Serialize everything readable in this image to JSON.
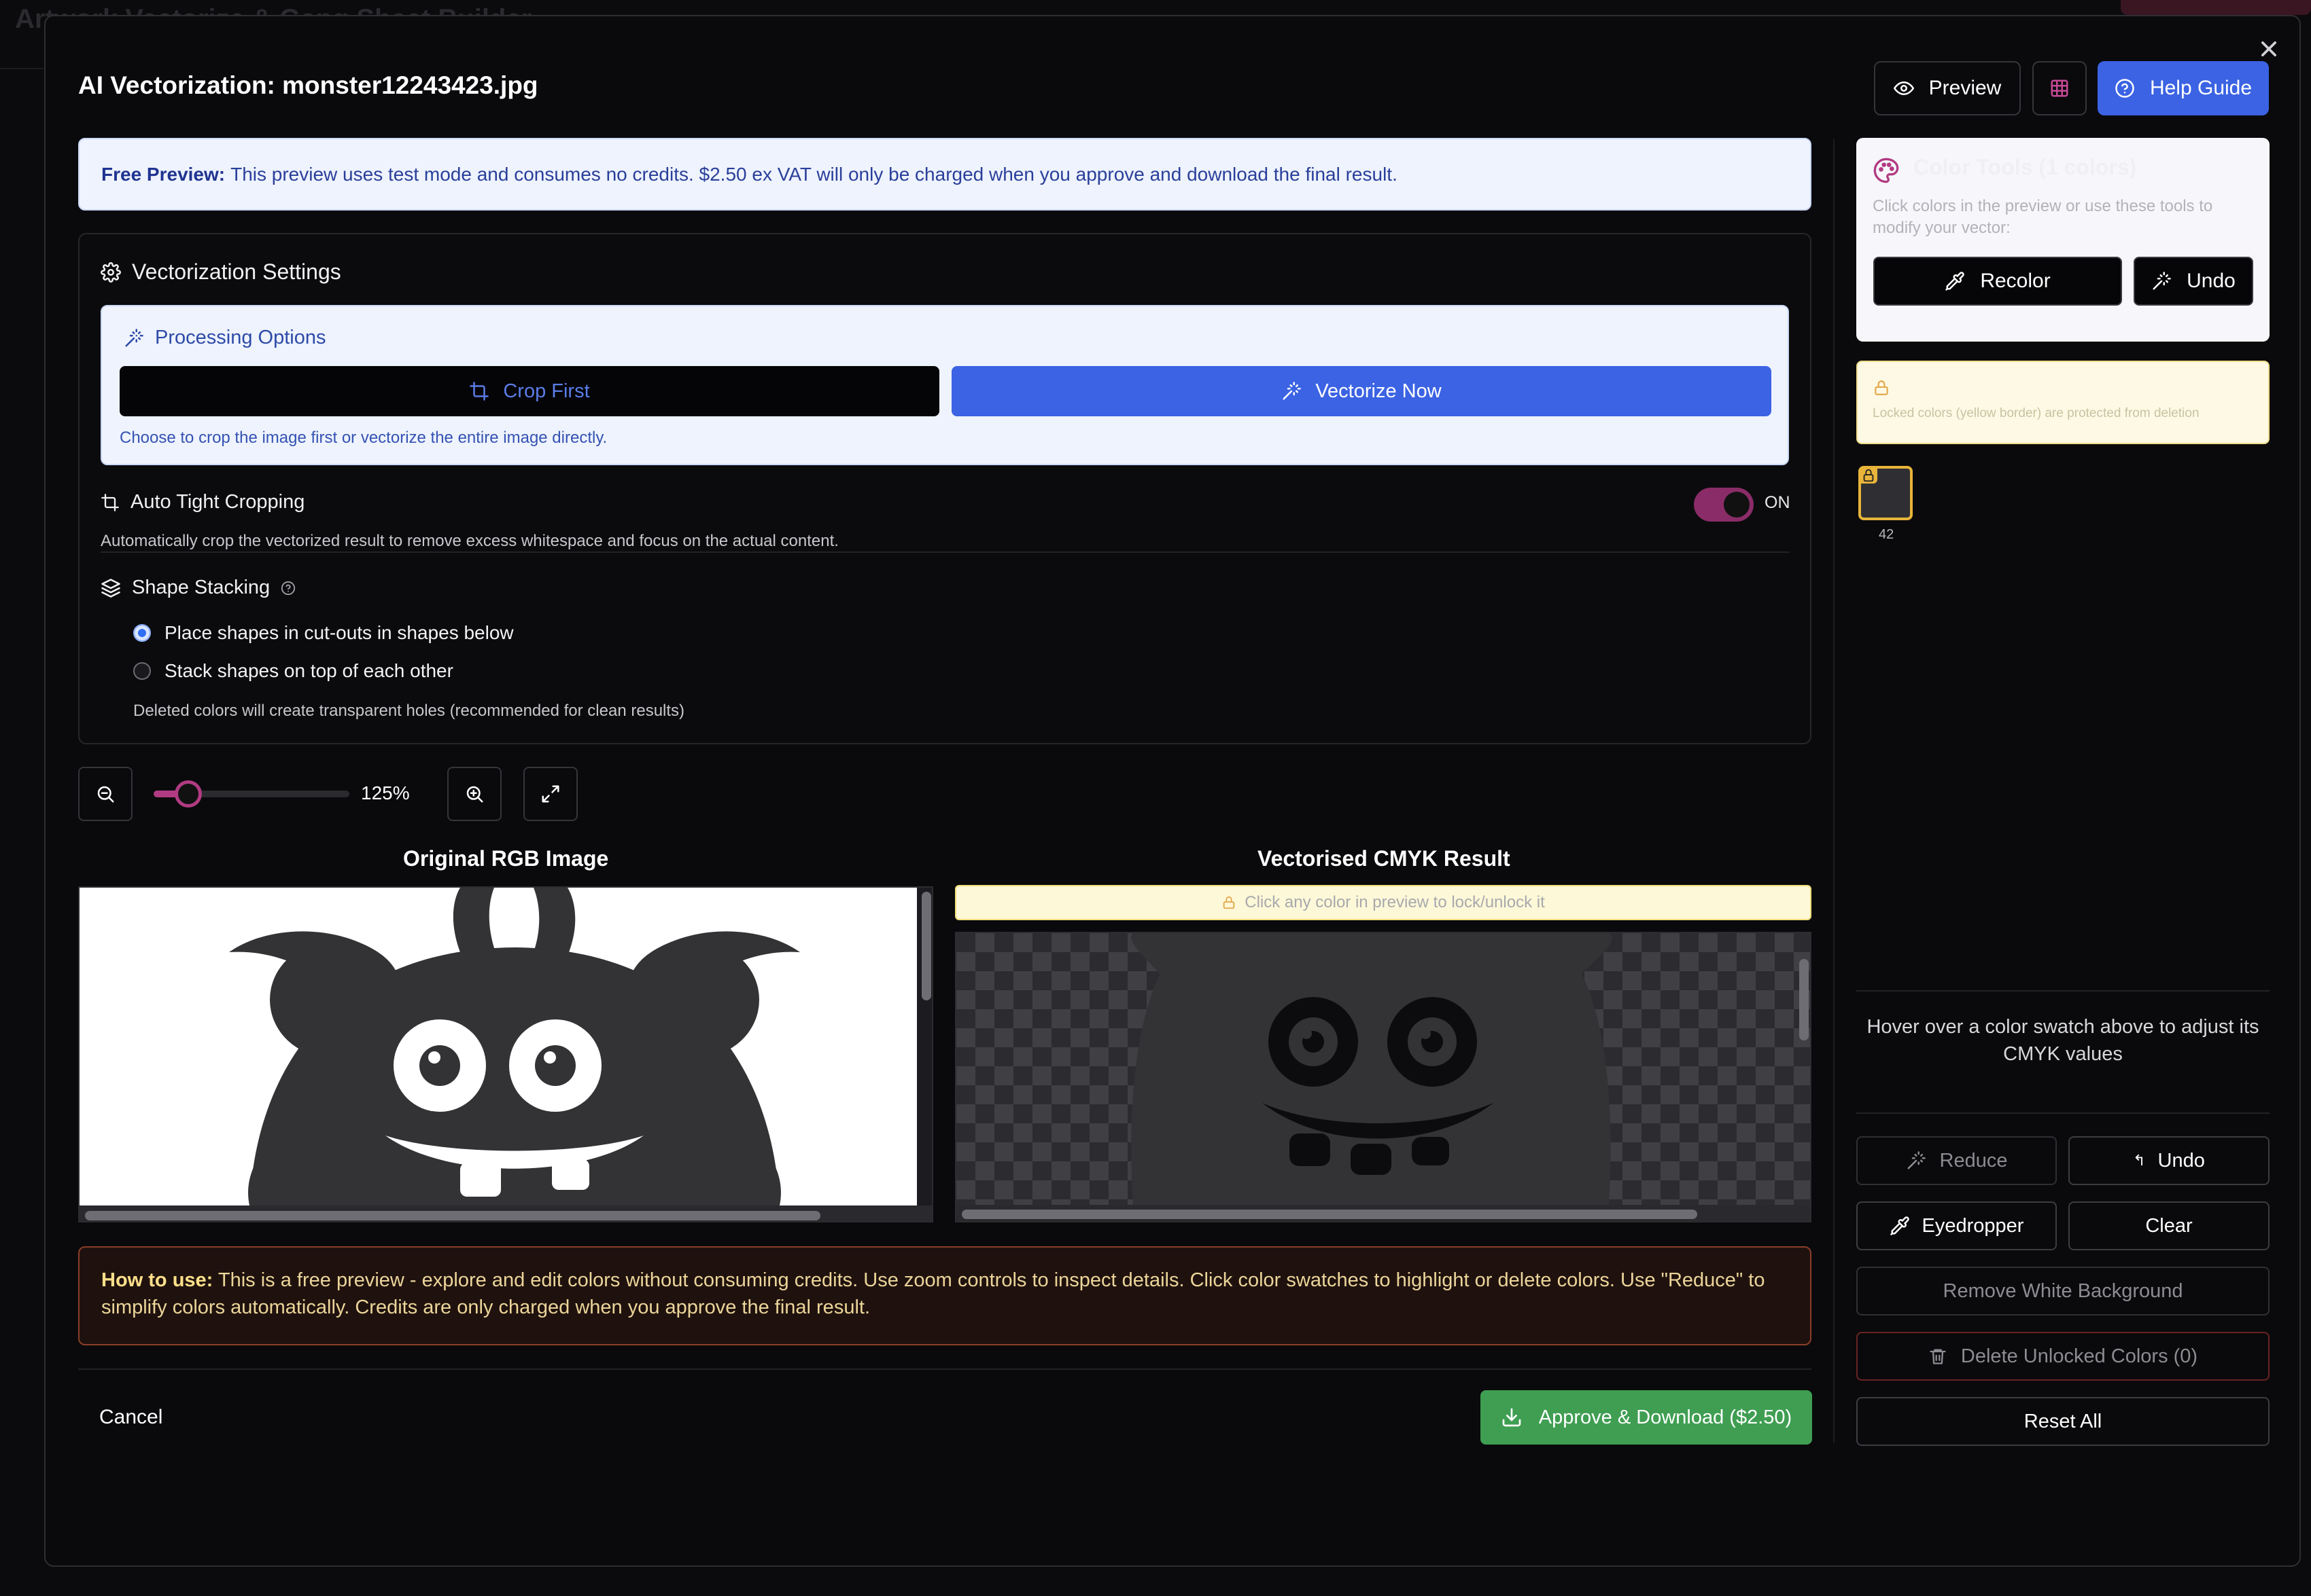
{
  "background_app": {
    "title": "Artwork Vectorize & Gang Sheet Builder"
  },
  "modal": {
    "title": "AI Vectorization: monster12243423.jpg",
    "close_icon": "close-icon",
    "header_buttons": {
      "preview": "Preview",
      "help": "Help Guide"
    }
  },
  "banner": {
    "bold": "Free Preview:",
    "text": "This preview uses test mode and consumes no credits. $2.50 ex VAT will only be charged when you approve and download the final result."
  },
  "settings": {
    "title": "Vectorization Settings",
    "processing": {
      "title": "Processing Options",
      "crop_label": "Crop First",
      "vectorize_label": "Vectorize Now",
      "note": "Choose to crop the image first or vectorize the entire image directly."
    },
    "auto_crop": {
      "title": "Auto Tight Cropping",
      "state": "ON",
      "enabled": true,
      "description": "Automatically crop the vectorized result to remove excess whitespace and focus on the actual content."
    },
    "shape_stacking": {
      "title": "Shape Stacking",
      "options": [
        "Place shapes in cut-outs in shapes below",
        "Stack shapes on top of each other"
      ],
      "selected": 0,
      "note": "Deleted colors will create transparent holes (recommended for clean results)"
    }
  },
  "zoom": {
    "value": "125%",
    "level_fraction": 0.12
  },
  "panels": {
    "original_title": "Original RGB Image",
    "vector_title": "Vectorised CMYK Result",
    "lock_hint": "Click any color in preview to lock/unlock it"
  },
  "howto": {
    "bold": "How to use:",
    "text": "This is a free preview - explore and edit colors without consuming credits. Use zoom controls to inspect details. Click color swatches to highlight or delete colors. Use \"Reduce\" to simplify colors automatically. Credits are only charged when you approve the final result."
  },
  "footer": {
    "cancel": "Cancel",
    "approve": "Approve & Download ($2.50)"
  },
  "color_tools": {
    "title": "Color Tools (1 colors)",
    "description": "Click colors in the preview or use these tools to modify your vector:",
    "recolor": "Recolor",
    "undo": "Undo",
    "lock_note": "Locked colors (yellow border) are protected from deletion",
    "swatches": [
      {
        "count": "42",
        "color": "#2f2f33",
        "locked": true
      }
    ],
    "hover_text": "Hover over a color swatch above to adjust its CMYK values",
    "reduce": "Reduce",
    "undo2": "Undo",
    "eyedropper": "Eyedropper",
    "clear": "Clear",
    "remove_white": "Remove White Background",
    "delete_unlocked": "Delete Unlocked Colors (0)",
    "reset_all": "Reset All"
  },
  "colors": {
    "accent_blue": "#3b63e3",
    "accent_magenta": "#b13b82",
    "approve_green": "#3f9e52",
    "lock_yellow": "#e8b43a"
  }
}
